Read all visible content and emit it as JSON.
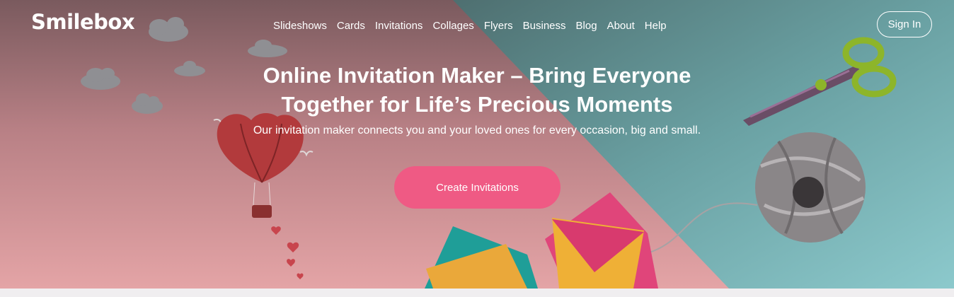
{
  "brand": {
    "logo_text": "Smilebox"
  },
  "nav": {
    "items": [
      "Slideshows",
      "Cards",
      "Invitations",
      "Collages",
      "Flyers",
      "Business",
      "Blog",
      "About",
      "Help"
    ],
    "signin_label": "Sign In"
  },
  "hero": {
    "headline_line1": "Online Invitation Maker – Bring Everyone",
    "headline_line2": "Together for Life’s Precious Moments",
    "subtitle": "Our invitation maker connects you and your loved ones for every occasion, big and small.",
    "cta_label": "Create Invitations"
  },
  "colors": {
    "pink_bg": "#c98c8c",
    "teal_bg": "#6aa6a6",
    "cta": "#ef5a84"
  },
  "icons": [
    "cloud-icon",
    "hot-air-balloon-icon",
    "bird-icon",
    "heart-icon",
    "scissors-icon",
    "yarn-ball-icon",
    "envelope-icon"
  ]
}
